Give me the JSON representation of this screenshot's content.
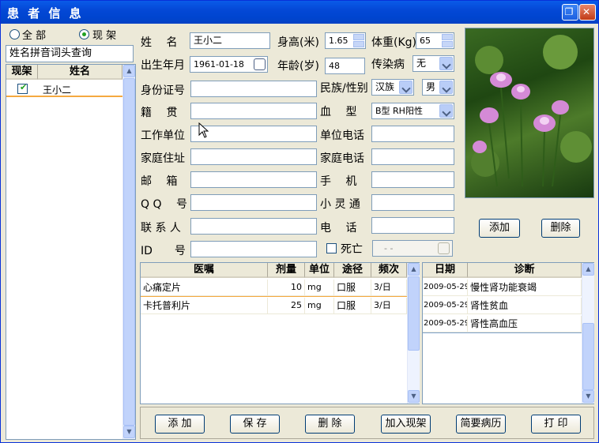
{
  "window": {
    "title": "患 者 信 息",
    "max": "❐",
    "close": "✕"
  },
  "left": {
    "radio_all": "全 部",
    "radio_current": "现 架",
    "search_placeholder": "姓名拼音词头查询",
    "col_current": "现架",
    "col_name": "姓名",
    "rows": [
      {
        "name": "王小二"
      }
    ]
  },
  "form": {
    "name_label": "姓　 名",
    "name_value": "王小二",
    "height_label": "身高(米)",
    "height_value": "1.65",
    "weight_label": "体重(Kg)",
    "weight_value": "65",
    "dob_label": "出生年月",
    "dob_value": "1961-01-18",
    "age_label": "年龄(岁)",
    "age_value": "48",
    "infect_label": "传染病",
    "infect_value": "无",
    "id_label": "身份证号",
    "id_value": "",
    "nation_label": "民族/性别",
    "nation_value": "汉族",
    "gender_value": "男",
    "origin_label": "籍　 贯",
    "blood_label": "血　 型",
    "blood_value": "B型 RH阳性",
    "work_label": "工作单位",
    "work_phone_label": "单位电话",
    "home_label": "家庭住址",
    "home_phone_label": "家庭电话",
    "mail_label": "邮　 箱",
    "mobile_label": "手　 机",
    "qq_label": "Q Q　 号",
    "lingtong_label": "小 灵 通",
    "contact_label": "联 系 人",
    "phone_label": "电　 话",
    "idno_label": "ID　　号",
    "dead_label": "死亡",
    "dead_date": "- -"
  },
  "photo": {
    "add": "添加",
    "delete": "删除"
  },
  "orders": {
    "headers": [
      "医嘱",
      "剂量",
      "单位",
      "途径",
      "频次"
    ],
    "rows": [
      [
        "心痛定片",
        "10",
        "mg",
        "口服",
        "3/日"
      ],
      [
        "卡托普利片",
        "25",
        "mg",
        "口服",
        "3/日"
      ]
    ]
  },
  "diag": {
    "headers": [
      "日期",
      "诊断"
    ],
    "rows": [
      [
        "2009-05-29",
        "慢性肾功能衰竭"
      ],
      [
        "2009-05-29",
        "肾性贫血"
      ],
      [
        "2009-05-29",
        "肾性高血压"
      ]
    ]
  },
  "bottom": {
    "add": "添 加",
    "save": "保 存",
    "delete": "删 除",
    "add_current": "加入现架",
    "summary": "简要病历",
    "print": "打 印"
  }
}
